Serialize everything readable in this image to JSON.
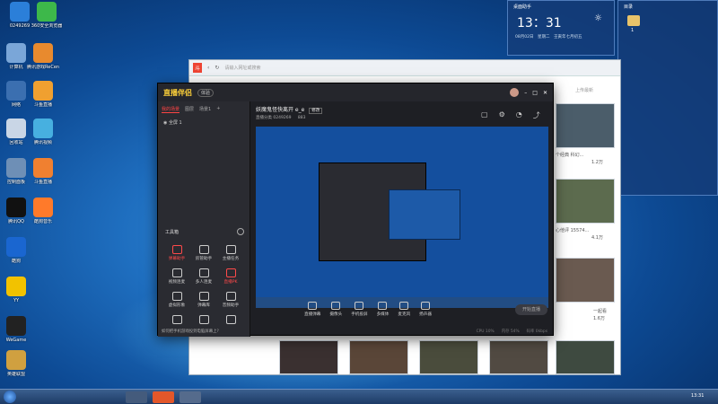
{
  "desktop_icons": [
    {
      "label": "0249269"
    },
    {
      "label": "360安全浏览器"
    },
    {
      "label": "计算机"
    },
    {
      "label": "腾讯游戏ReCenter"
    },
    {
      "label": "网络"
    },
    {
      "label": "斗鱼直播"
    },
    {
      "label": "回收站"
    },
    {
      "label": "腾讯视频"
    },
    {
      "label": "控制面板"
    },
    {
      "label": "斗鱼直播"
    },
    {
      "label": "腾讯QQ"
    },
    {
      "label": "酷狗音乐"
    },
    {
      "label": "酷狗"
    },
    {
      "label": "YY"
    },
    {
      "label": "WeGame"
    },
    {
      "label": "英雄联盟"
    },
    {
      "label": "设置"
    }
  ],
  "clock_widget": {
    "title": "桌面助手",
    "time": "13：31",
    "date": "08月02日　星期二　壬寅年七月初五"
  },
  "folder_widget": {
    "title": "目录",
    "item_count": "1"
  },
  "browser": {
    "address": "请输入网址或搜索",
    "right_label": "上传最新",
    "captions": [
      "个经典 科幻...",
      "1.2万",
      "心他评 15574...",
      "4.1万",
      "一起看",
      "1.6万"
    ]
  },
  "app": {
    "logo": "直播伴侣",
    "version": "体验",
    "side_tabs": [
      "我的场景",
      "图层",
      "场景1"
    ],
    "scene_item": "全屏 1",
    "tools_title": "工具箱",
    "tools": [
      {
        "label": "弹幕助手",
        "red": true
      },
      {
        "label": "房管助手",
        "red": false
      },
      {
        "label": "主播任务",
        "red": false
      },
      {
        "label": "视频连麦",
        "red": false
      },
      {
        "label": "多人连麦",
        "red": false
      },
      {
        "label": "直播PK",
        "red": true
      },
      {
        "label": "虚拟形象",
        "red": false
      },
      {
        "label": "弹幕库",
        "red": false
      },
      {
        "label": "音频助手",
        "red": false
      },
      {
        "label": "",
        "red": false
      },
      {
        "label": "",
        "red": false
      },
      {
        "label": "",
        "red": false
      }
    ],
    "stream_title": "妖魔鬼怪快离开 e_e",
    "edit": "修改",
    "room_tag": "直播分类 0249269",
    "viewers": "883",
    "bottom_buttons": [
      "直播弹幕",
      "摄像头",
      "手机投屏",
      "多媒体",
      "麦克风",
      "扬声器"
    ],
    "start_button": "开始直播",
    "status": [
      "CPU 10%",
      "内存 54%",
      "码率 0kbps"
    ],
    "tip": "如何把手机游戏投到电脑屏幕上?"
  },
  "taskbar": {
    "time": "13:31"
  }
}
